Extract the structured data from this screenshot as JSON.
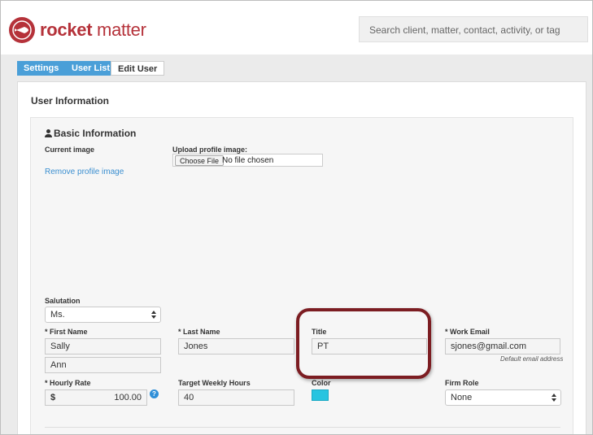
{
  "header": {
    "logo_bold": "rocket",
    "logo_light": "matter",
    "search_placeholder": "Search client, matter, contact, activity, or tag"
  },
  "breadcrumb": {
    "items": [
      "Settings",
      "User List",
      "Edit User"
    ]
  },
  "panel": {
    "title": "User Information",
    "section_title": "Basic Information"
  },
  "image": {
    "current_label": "Current image",
    "remove_link": "Remove profile image",
    "upload_label": "Upload profile image:",
    "choose_button": "Choose File",
    "no_file_text": "No file chosen"
  },
  "form": {
    "salutation_label": "Salutation",
    "salutation_value": "Ms.",
    "first_name_label": "First Name",
    "first_name_value": "Sally",
    "middle_name_value": "Ann",
    "last_name_label": "Last Name",
    "last_name_value": "Jones",
    "title_label": "Title",
    "title_value": "PT",
    "work_email_label": "Work Email",
    "work_email_value": "sjones@gmail.com",
    "default_email_hint": "Default email address",
    "hourly_rate_label": "Hourly Rate",
    "hourly_rate_currency": "$",
    "hourly_rate_value": "100.00",
    "help_glyph": "?",
    "target_hours_label": "Target Weekly Hours",
    "target_hours_value": "40",
    "color_label": "Color",
    "color_value": "#27c4e0",
    "firm_role_label": "Firm Role",
    "firm_role_value": "None",
    "required_marker": "*"
  },
  "colors": {
    "brand": "#b5323a",
    "breadcrumb": "#4a9fd8",
    "link": "#3b8fd0",
    "highlight_ring": "#7c1d22"
  },
  "icons": {
    "logo": "rocket-logo-icon",
    "section": "person-icon",
    "help": "help-icon",
    "select_arrows": "up-down-arrows-icon"
  }
}
